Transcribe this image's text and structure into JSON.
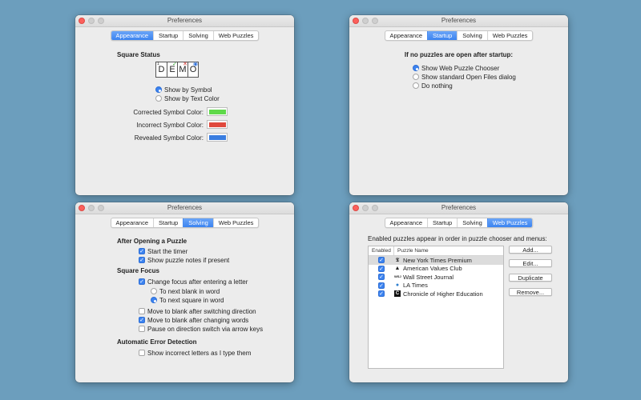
{
  "window_title": "Preferences",
  "tabs": [
    "Appearance",
    "Startup",
    "Solving",
    "Web Puzzles"
  ],
  "appearance": {
    "heading": "Square Status",
    "demo": {
      "letters": [
        "D",
        "E",
        "M",
        "O"
      ],
      "clue_number": "1",
      "marks": [
        "",
        "✓",
        "✕",
        "◉"
      ]
    },
    "options": [
      "Show by Symbol",
      "Show by Text Color"
    ],
    "selected": "Show by Symbol",
    "colors": [
      {
        "label": "Corrected Symbol Color:",
        "value": "#5fd94a"
      },
      {
        "label": "Incorrect Symbol Color:",
        "value": "#e0483c"
      },
      {
        "label": "Revealed Symbol Color:",
        "value": "#3a7de0"
      }
    ]
  },
  "startup": {
    "heading": "If no puzzles are open after startup:",
    "options": [
      "Show Web Puzzle Chooser",
      "Show standard Open Files dialog",
      "Do nothing"
    ],
    "selected": "Show Web Puzzle Chooser"
  },
  "solving": {
    "after_opening": {
      "heading": "After Opening a Puzzle",
      "items": [
        {
          "label": "Start the timer",
          "checked": true
        },
        {
          "label": "Show puzzle notes if present",
          "checked": true
        }
      ]
    },
    "square_focus": {
      "heading": "Square Focus",
      "change_focus": {
        "label": "Change focus after entering a letter",
        "checked": true
      },
      "radios": [
        {
          "label": "To next blank in word",
          "selected": false
        },
        {
          "label": "To next square in word",
          "selected": true
        }
      ],
      "items": [
        {
          "label": "Move to blank after switching direction",
          "checked": false
        },
        {
          "label": "Move to blank after changing words",
          "checked": true
        },
        {
          "label": "Pause on direction switch via arrow keys",
          "checked": false
        }
      ]
    },
    "error_detection": {
      "heading": "Automatic Error Detection",
      "items": [
        {
          "label": "Show incorrect letters as I type them",
          "checked": false
        }
      ]
    }
  },
  "web_puzzles": {
    "intro": "Enabled puzzles appear in order in puzzle chooser and menus:",
    "columns": [
      "Enabled",
      "Puzzle Name"
    ],
    "rows": [
      {
        "name": "New York Times Premium",
        "enabled": true,
        "icon": "nyt-icon",
        "glyph": "𝕿"
      },
      {
        "name": "American Values Club",
        "enabled": true,
        "icon": "avc-icon",
        "glyph": "▲"
      },
      {
        "name": "Wall Street Journal",
        "enabled": true,
        "icon": "wsj-icon",
        "glyph": "WSJ"
      },
      {
        "name": "LA Times",
        "enabled": true,
        "icon": "globe-icon",
        "glyph": "●"
      },
      {
        "name": "Chronicle of Higher Education",
        "enabled": true,
        "icon": "che-icon",
        "glyph": "C"
      }
    ],
    "buttons": [
      "Add...",
      "Edit...",
      "Duplicate",
      "Remove..."
    ]
  }
}
